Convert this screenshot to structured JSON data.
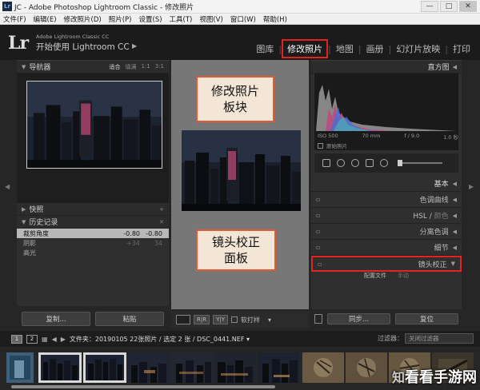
{
  "window": {
    "title": "JC - Adobe Photoshop Lightroom Classic - 修改照片",
    "min": "—",
    "max": "□",
    "close": "✕"
  },
  "menu": [
    "文件(F)",
    "编辑(E)",
    "修改照片(D)",
    "照片(P)",
    "设置(S)",
    "工具(T)",
    "视图(V)",
    "窗口(W)",
    "帮助(H)"
  ],
  "header": {
    "logo": "Lr",
    "brand_small": "Adobe Lightroom Classic CC",
    "brand_big": "开始使用 Lightroom CC",
    "modules": [
      "图库",
      "修改照片",
      "地图",
      "画册",
      "幻灯片放映",
      "打印"
    ]
  },
  "left": {
    "navigator_title": "导航器",
    "zoom_options": [
      "适合",
      "填满",
      "1:1",
      "3:1"
    ],
    "snapshots_title": "快照",
    "history_title": "历史记录",
    "history": [
      {
        "name": "裁剪角度",
        "v1": "-0.80",
        "v2": "-0.80"
      },
      {
        "name": "阴影",
        "v1": "+34",
        "v2": "34"
      },
      {
        "name": "高光",
        "v1": "",
        "v2": ""
      }
    ],
    "copy_button": "复制...",
    "paste_button": "粘贴"
  },
  "center": {
    "softproof_label": "软打样"
  },
  "right": {
    "histogram_title": "直方图",
    "histo_stats": [
      "ISO 500",
      "70 mm",
      "f / 9.0",
      "1.0 秒"
    ],
    "original_label": "原始照片",
    "sections": [
      {
        "label": "基本",
        "dim": ""
      },
      {
        "label": "色调曲线",
        "dim": ""
      },
      {
        "label": "HSL / ",
        "dim": "颜色"
      },
      {
        "label": "分离色调",
        "dim": ""
      },
      {
        "label": "细节",
        "dim": ""
      },
      {
        "label": "镜头校正",
        "dim": ""
      }
    ],
    "lens_tabs": [
      "配置文件",
      "手动"
    ],
    "sync_button": "同步...",
    "reset_button": "复位"
  },
  "filmstrip_bar": {
    "screens": [
      "1",
      "2"
    ],
    "path": "文件夹：20190105   22张照片 / 选定 2 张 / DSC_0441.NEF ▾",
    "filter_label": "过滤器：",
    "filter_value": "关闭过滤器"
  },
  "callouts": {
    "develop": [
      "修改照片",
      "板块"
    ],
    "lens": [
      "镜头校正",
      "面板"
    ]
  },
  "watermark": {
    "pre": "知",
    "text": "看看手游网"
  },
  "colors": {
    "highlight_red": "#e32320",
    "callout_fill": "#f3e6d6",
    "callout_border": "#e05a34",
    "bg_dark": "#262626"
  }
}
